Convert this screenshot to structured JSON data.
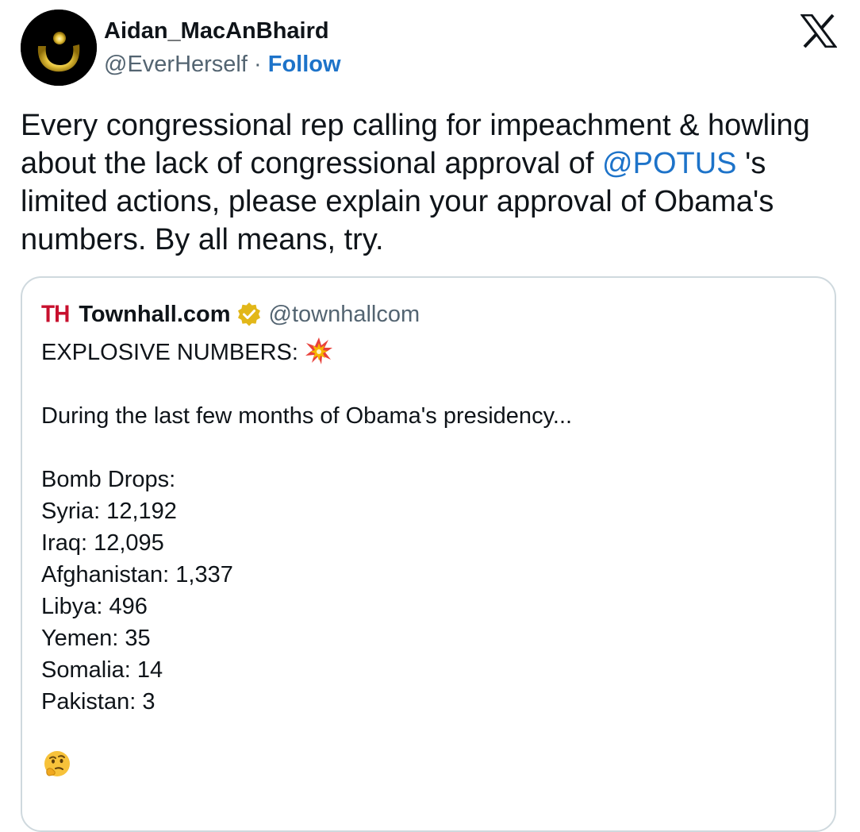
{
  "author": {
    "display_name": "Aidan_MacAnBhaird",
    "handle": "@EverHerself",
    "separator": "·",
    "follow_label": "Follow",
    "avatar_icon": "gold-nun-symbol-icon"
  },
  "platform_icon": "x-logo-icon",
  "tweet": {
    "text_before": "Every congressional rep calling for impeachment & howling about the lack of congressional approval of ",
    "mention": "@POTUS",
    "text_after": " 's limited actions, please explain your approval of Obama's numbers. By all means, try."
  },
  "quoted_tweet": {
    "logo_text": "TH",
    "display_name": "Townhall.com",
    "handle": "@townhallcom",
    "verified_icon": "gold-verified-badge-icon",
    "headline": "EXPLOSIVE NUMBERS:",
    "headline_icon": "collision-emoji-icon",
    "intro": "During the last few months of Obama's presidency...",
    "list_title": "Bomb Drops:",
    "items": [
      "Syria: 12,192",
      "Iraq: 12,095",
      "Afghanistan: 1,337",
      "Libya: 496",
      "Yemen: 35",
      "Somalia: 14",
      "Pakistan: 3"
    ],
    "closing_icon": "thinking-face-emoji-icon"
  },
  "colors": {
    "link_blue": "#1d73c9",
    "secondary_text": "#536471",
    "border": "#cfd9de",
    "townhall_red": "#c8102e",
    "verified_gold": "#e2b719"
  }
}
